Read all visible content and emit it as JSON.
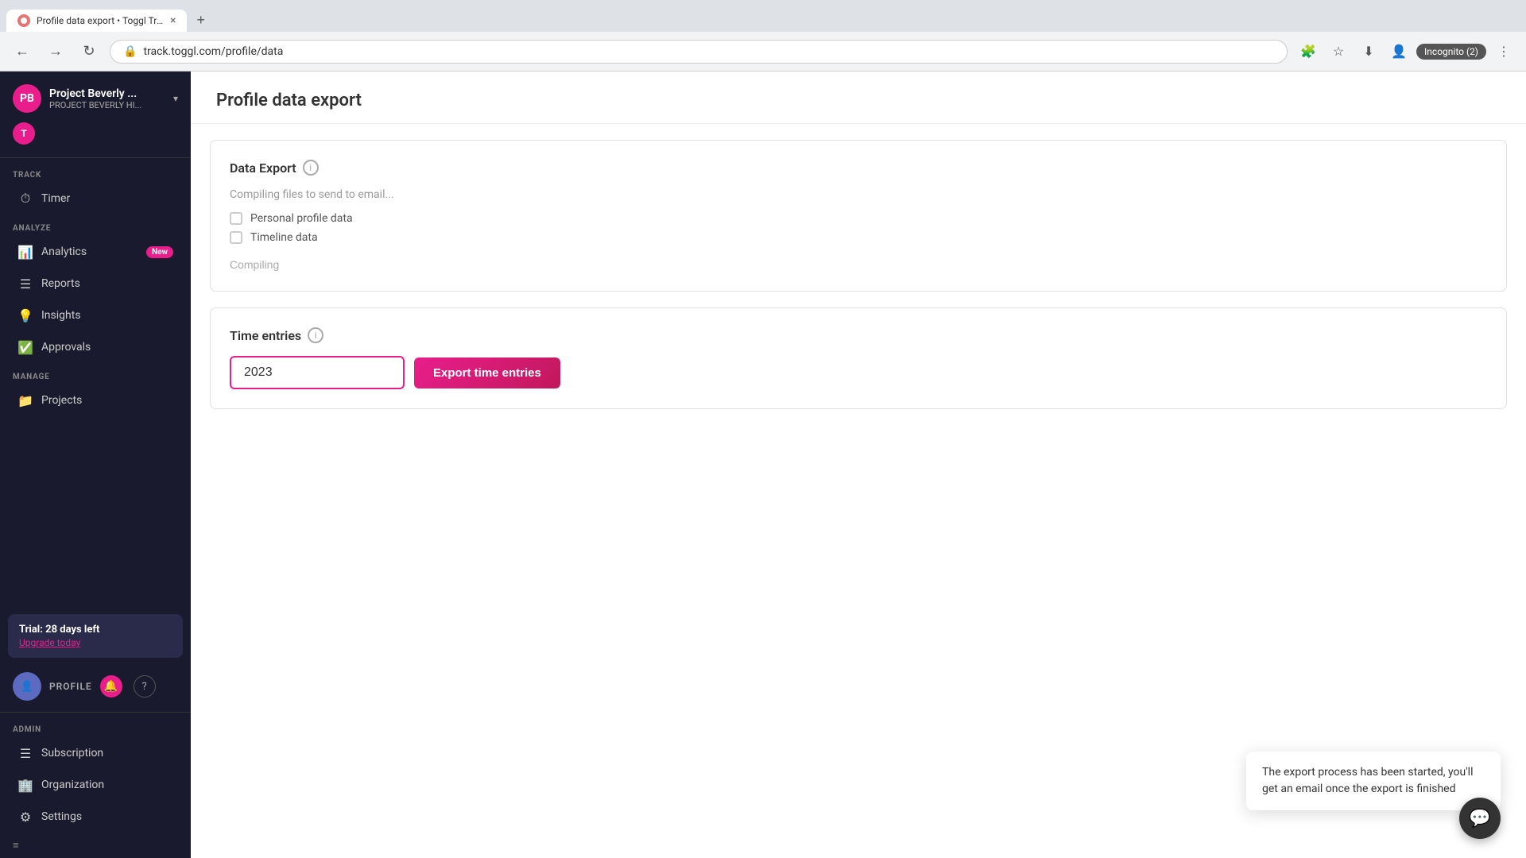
{
  "browser": {
    "tab_title": "Profile data export • Toggl Trac...",
    "close_label": "×",
    "new_tab_label": "+",
    "back_label": "←",
    "forward_label": "→",
    "refresh_label": "↻",
    "url": "track.toggl.com/profile/data",
    "incognito_label": "Incognito (2)"
  },
  "sidebar": {
    "workspace_name": "Project Beverly ...",
    "workspace_sub": "PROJECT BEVERLY HI...",
    "track_section": "TRACK",
    "timer_label": "Timer",
    "analyze_section": "ANALYZE",
    "analytics_label": "Analytics",
    "analytics_badge": "New",
    "reports_label": "Reports",
    "insights_label": "Insights",
    "approvals_label": "Approvals",
    "manage_section": "MANAGE",
    "projects_label": "Projects",
    "trial_title": "Trial: 28 days left",
    "upgrade_label": "Upgrade today",
    "profile_label": "PROFILE",
    "admin_section": "ADMIN",
    "subscription_label": "Subscription",
    "organization_label": "Organization",
    "settings_label": "Settings"
  },
  "main": {
    "page_title": "Profile data export",
    "data_export_title": "Data Export",
    "compiling_text": "Compiling files to send to email...",
    "personal_profile_label": "Personal profile data",
    "timeline_label": "Timeline data",
    "compiling_label": "Compiling",
    "time_entries_title": "Time entries",
    "year_value": "2023",
    "export_btn_label": "Export time entries",
    "toast_text": "The export process has been started, you'll get an email once the export is finished"
  }
}
